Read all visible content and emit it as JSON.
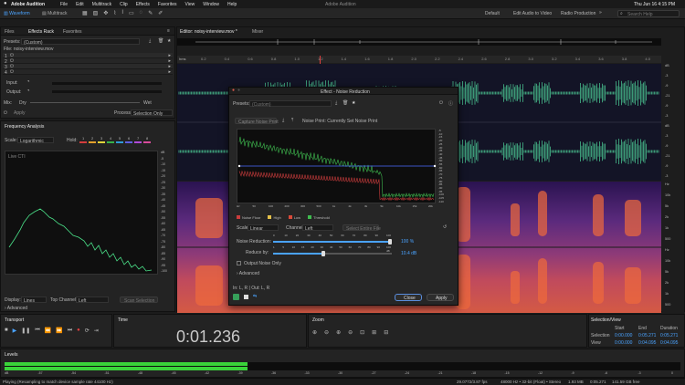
{
  "macbar": {
    "app": "Adobe Audition",
    "menus": [
      "File",
      "Edit",
      "Multitrack",
      "Clip",
      "Effects",
      "Favorites",
      "View",
      "Window",
      "Help"
    ],
    "window_title": "Adobe Audition",
    "clock": "Thu Jun 16  4:15 PM"
  },
  "toolbar": {
    "waveform": "Waveform",
    "multitrack": "Multitrack",
    "workspaces": [
      "Default",
      "Edit Audio to Video",
      "Radio Production"
    ],
    "search_placeholder": "Search Help"
  },
  "left": {
    "tabs": [
      "Files",
      "Effects Rack",
      "Favorites"
    ],
    "presets_label": "Presets:",
    "preset_value": "(Custom)",
    "file_label": "File: noisy-interview.mov",
    "rack_slots": [
      "1",
      "2",
      "3",
      "4"
    ],
    "input_label": "Input:",
    "output_label": "Output:",
    "mix_label": "Mix:",
    "dry_label": "Dry",
    "wet_label": "Wet",
    "process_label": "Process:",
    "process_value": "Selection Only",
    "apply_label": "Apply"
  },
  "freq": {
    "title": "Frequency Analysis",
    "scale_label": "Scale:",
    "scale_value": "Logarithmic",
    "hold_label": "Hold:",
    "hold_slots": [
      "1",
      "2",
      "3",
      "4",
      "5",
      "6",
      "7",
      "8"
    ],
    "hold_colors": [
      "#d43c3c",
      "#e3a02a",
      "#e0d23a",
      "#36b24a",
      "#2f9ad8",
      "#5f5fe0",
      "#b04bd8",
      "#d84b9a"
    ],
    "live_label": "Live CTI",
    "db_ticks": [
      "dB",
      "-5",
      "-10",
      "-15",
      "-20",
      "-25",
      "-30",
      "-35",
      "-40",
      "-45",
      "-50",
      "-55",
      "-60",
      "-65",
      "-70",
      "-75",
      "-80",
      "-85",
      "-90",
      "-95",
      "-100"
    ],
    "display_label": "Display:",
    "display_value": "Lines",
    "channel_label": "Top Channel:",
    "channel_value": "Left",
    "scan_label": "Scan Selection",
    "advanced_label": "Advanced"
  },
  "editor": {
    "tab": "Editor: noisy-interview.mov *",
    "mixer_tab": "Mixer",
    "ruler_label": "hms",
    "ruler_ticks": [
      "0.2",
      "0.4",
      "0.6",
      "0.8",
      "1.0",
      "1.2",
      "1.4",
      "1.6",
      "1.8",
      "2.0",
      "2.2",
      "2.4",
      "2.6",
      "2.8",
      "3.0",
      "3.2",
      "3.4",
      "3.6",
      "3.8",
      "4.0"
    ],
    "db_right": [
      "dB",
      "-3",
      "-9",
      "-21",
      "-9",
      "-3",
      "dB",
      "-3",
      "-9",
      "-21",
      "-9",
      "-3"
    ],
    "hz_right": [
      "Hz",
      "10k",
      "5k",
      "2k",
      "1k",
      "500",
      "Hz",
      "10k",
      "5k",
      "2k",
      "1k",
      "500"
    ]
  },
  "dialog": {
    "title": "Effect - Noise Reduction",
    "presets_label": "Presets:",
    "preset_value": "(Custom)",
    "capture_label": "Capture Noise Print",
    "noiseprint_label": "Noise Print: Currently Set Noise Print",
    "y_ticks": [
      "-5",
      "-10",
      "-15",
      "-20",
      "-25",
      "-30",
      "-35",
      "-40",
      "-45",
      "-50",
      "-55",
      "-60",
      "-65",
      "-70",
      "-75",
      "-80",
      "-85",
      "-90",
      "-95",
      "-100",
      "-105",
      "-110"
    ],
    "x_ticks": [
      "Hz",
      "50",
      "100",
      "200",
      "300",
      "500",
      "1k",
      "2k",
      "3k",
      "5k",
      "10k",
      "15k",
      "20k"
    ],
    "legend": [
      {
        "label": "Noise Floor",
        "color": "#c93c3c"
      },
      {
        "label": "High",
        "color": "#e6c24a"
      },
      {
        "label": "Low",
        "color": "#d94a3a"
      },
      {
        "label": "Threshold",
        "color": "#3fbb4f"
      }
    ],
    "scale_label": "Scale:",
    "scale_value": "Linear",
    "channel_label": "Channel:",
    "channel_value": "Left",
    "select_file_label": "Select Entire File",
    "nr_label": "Noise Reduction:",
    "nr_ticks": [
      "0",
      "10",
      "20",
      "30",
      "40",
      "50",
      "60",
      "70",
      "80",
      "90",
      "100"
    ],
    "nr_value": "100 %",
    "nr_fraction": 1.0,
    "reduce_label": "Reduce by:",
    "reduce_ticks": [
      "1",
      "5",
      "10",
      "15",
      "20",
      "30",
      "40",
      "50",
      "60",
      "70",
      "80",
      "90",
      "100 dB"
    ],
    "reduce_value": "10.4 dB",
    "reduce_fraction": 0.42,
    "output_noise_label": "Output Noise Only",
    "advanced_label": "Advanced",
    "io_label": "In: L, R | Out: L, R",
    "close_label": "Close",
    "apply_label": "Apply"
  },
  "transport": {
    "title": "Transport",
    "time_title": "Time",
    "time_value": "0:01.236",
    "zoom_title": "Zoom"
  },
  "selection": {
    "title": "Selection/View",
    "headers": [
      "Start",
      "End",
      "Duration"
    ],
    "rows": [
      {
        "label": "Selection",
        "start": "0:00.000",
        "end": "0:05.271",
        "duration": "0:05.271"
      },
      {
        "label": "View",
        "start": "0:00.000",
        "end": "0:04.095",
        "duration": "0:04.095"
      }
    ]
  },
  "levels": {
    "title": "Levels",
    "ticks": [
      "dB",
      "-57",
      "-54",
      "-51",
      "-48",
      "-45",
      "-42",
      "-39",
      "-36",
      "-33",
      "-30",
      "-27",
      "-24",
      "-21",
      "-18",
      "-15",
      "-12",
      "-9",
      "-6",
      "-3",
      "0"
    ],
    "level_fraction": 0.36
  },
  "status": {
    "left": "Playing (Resampling to match device sample rate 44100 Hz)",
    "center": "29.0772/3.87 fps",
    "right": [
      "48000 Hz • 32-bit (Float) • Stereo",
      "1.93 MB",
      "0:05.271",
      "141.59 GB free"
    ]
  }
}
